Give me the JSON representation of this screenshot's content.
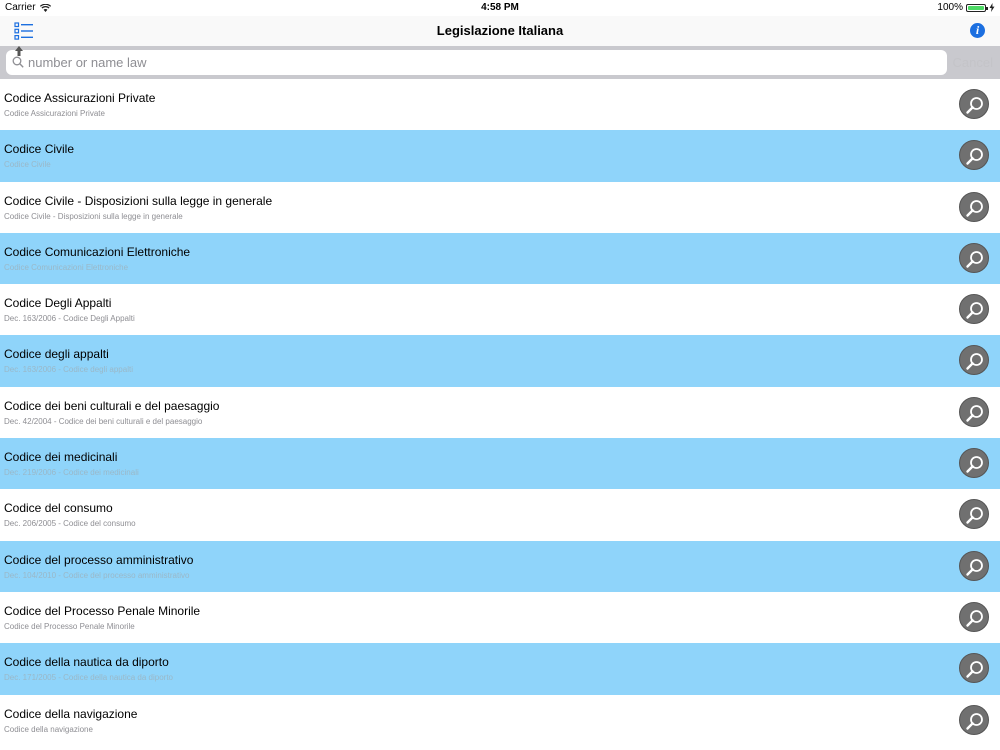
{
  "status_bar": {
    "carrier": "Carrier",
    "time": "4:58 PM",
    "battery": "100%",
    "battery_level": 1.0
  },
  "nav_bar": {
    "title": "Legislazione Italiana",
    "left_icon": "list-icon",
    "right_icon": "info-icon",
    "info_glyph": "i"
  },
  "search": {
    "placeholder": "number or name law",
    "value": "",
    "cancel_label": "Cancel"
  },
  "laws": [
    {
      "title": "Codice Assicurazioni Private",
      "subtitle": "Codice Assicurazioni Private"
    },
    {
      "title": "Codice Civile",
      "subtitle": "Codice Civile"
    },
    {
      "title": "Codice Civile - Disposizioni sulla legge in generale",
      "subtitle": "Codice Civile - Disposizioni sulla legge in generale"
    },
    {
      "title": "Codice Comunicazioni Elettroniche",
      "subtitle": "Codice Comunicazioni Elettroniche"
    },
    {
      "title": "Codice Degli Appalti",
      "subtitle": "Dec. 163/2006 - Codice Degli Appalti"
    },
    {
      "title": "Codice degli appalti",
      "subtitle": "Dec. 163/2006 - Codice degli appalti"
    },
    {
      "title": "Codice dei beni culturali e del paesaggio",
      "subtitle": "Dec. 42/2004 - Codice dei beni culturali e del paesaggio"
    },
    {
      "title": "Codice dei medicinali",
      "subtitle": "Dec. 219/2006 - Codice dei medicinali"
    },
    {
      "title": "Codice del consumo",
      "subtitle": "Dec. 206/2005 - Codice del consumo"
    },
    {
      "title": "Codice del processo amministrativo",
      "subtitle": "Dec. 104/2010 - Codice del processo amministrativo"
    },
    {
      "title": "Codice del Processo Penale Minorile",
      "subtitle": "Codice del Processo Penale Minorile"
    },
    {
      "title": "Codice della nautica da diporto",
      "subtitle": "Dec. 171/2005 - Codice della nautica da diporto"
    },
    {
      "title": "Codice della navigazione",
      "subtitle": "Codice della navigazione"
    }
  ],
  "colors": {
    "row_alt": "#8fd4fa",
    "accent": "#1c6fe0",
    "search_button": "#707070"
  }
}
